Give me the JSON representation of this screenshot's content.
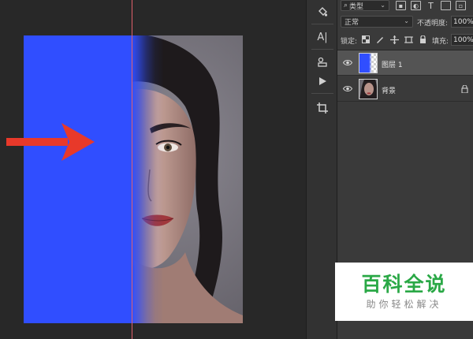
{
  "layers_panel": {
    "filter": {
      "label": "类型",
      "search_glyph": "⌕",
      "caret": "⌄"
    },
    "filter_icons": [
      "image-filter-icon",
      "adjustment-filter-icon",
      "type-filter-icon",
      "shape-filter-icon",
      "smart-object-filter-icon"
    ],
    "blend_mode": "正常",
    "opacity_label": "不透明度:",
    "opacity_value": "100%",
    "lock_label": "锁定:",
    "fill_label": "填充:",
    "fill_value": "100%",
    "layers": [
      {
        "name": "图层 1",
        "selected": true
      },
      {
        "name": "背景",
        "selected": false,
        "locked": true
      }
    ]
  },
  "toolbar": {
    "tools": [
      "paint-bucket-icon",
      "character-icon",
      "properties-icon",
      "play-actions-icon",
      "crop-icon"
    ],
    "labels": {
      "character": "A|"
    }
  },
  "watermark": {
    "title": "百科全说",
    "subtitle": "助你轻松解决"
  },
  "colors": {
    "blue_fill": "#304eff",
    "arrow_red": "#e8392a",
    "guide_line": "#e0606a",
    "watermark_green": "#2aa846",
    "panel_bg": "#3a3a3a",
    "canvas_bg": "#282828"
  }
}
